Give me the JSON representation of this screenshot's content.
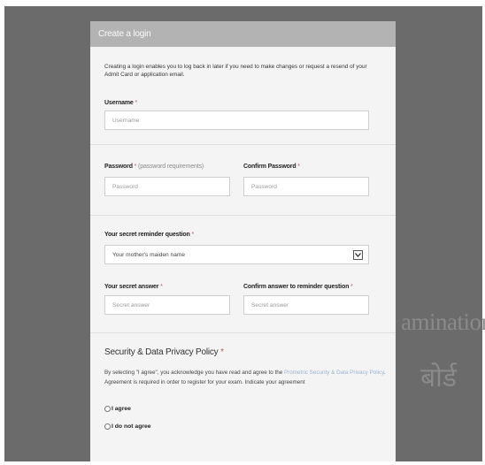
{
  "watermark": {
    "english": "aminations",
    "hindi": "बोर्ड"
  },
  "panel": {
    "title": "Create a login",
    "intro": "Creating a login enables you to log back in later if you need to make changes or request a resend of your Admit Card or application email."
  },
  "username": {
    "label": "Username",
    "required_mark": "*",
    "placeholder": "Username"
  },
  "password": {
    "label": "Password",
    "required_mark": "*",
    "hint": "(password requirements)",
    "placeholder": "Password"
  },
  "confirm_password": {
    "label": "Confirm Password",
    "required_mark": "*",
    "placeholder": "Password"
  },
  "secret_question": {
    "label": "Your secret reminder question",
    "required_mark": "*",
    "selected": "Your mother's maiden name"
  },
  "secret_answer": {
    "label": "Your secret answer",
    "required_mark": "*",
    "placeholder": "Secret answer"
  },
  "confirm_answer": {
    "label": "Confirm answer to reminder question",
    "required_mark": "*",
    "placeholder": "Secret answer"
  },
  "policy": {
    "title": "Security & Data Privacy Policy",
    "required_mark": "*",
    "text_before": "By selecting \"I agree\", you acknowledge you have read and agree to the",
    "link": "Prometric Security & Data Privacy Policy",
    "text_after": ". Agreement is required in order to register for your exam. Indicate your agreement",
    "agree_label": "I agree",
    "disagree_label": "I do not agree"
  }
}
